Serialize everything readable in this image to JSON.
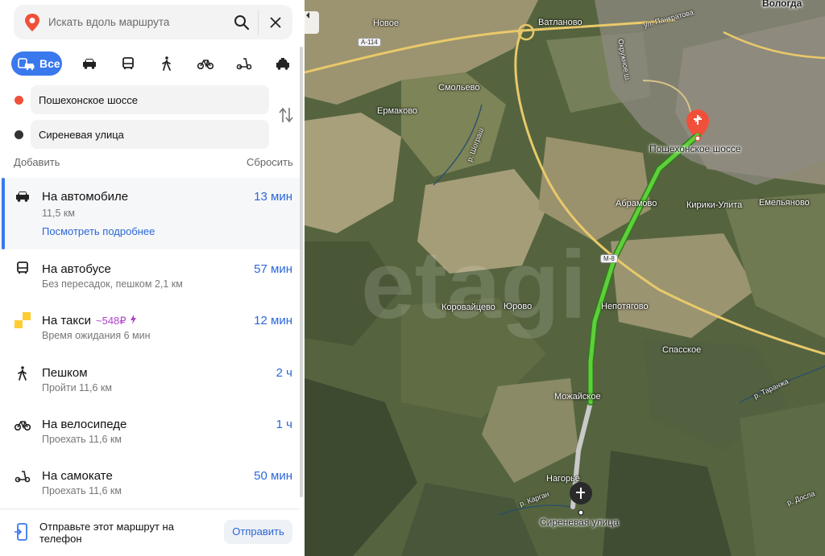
{
  "search": {
    "placeholder": "Искать вдоль маршрута"
  },
  "modes": {
    "all_label": "Все"
  },
  "waypoints": {
    "from": "Пошехонское шоссе",
    "to": "Сиреневая улица"
  },
  "actions": {
    "add": "Добавить",
    "reset": "Сбросить"
  },
  "routes": [
    {
      "title": "На автомобиле",
      "sub": "11,5 км",
      "time": "13 мин",
      "more": "Посмотреть подробнее",
      "icon": "car-icon"
    },
    {
      "title": "На автобусе",
      "sub": "Без пересадок, пешком 2,1 км",
      "time": "57 мин",
      "icon": "bus-icon"
    },
    {
      "title": "На такси",
      "price": "~548₽",
      "sub": "Время ожидания 6 мин",
      "time": "12 мин",
      "icon": "taxi-icon"
    },
    {
      "title": "Пешком",
      "sub": "Пройти 11,6 км",
      "time": "2 ч",
      "icon": "walk-icon"
    },
    {
      "title": "На велосипеде",
      "sub": "Проехать 11,6 км",
      "time": "1 ч",
      "icon": "bicycle-icon"
    },
    {
      "title": "На самокате",
      "sub": "Проехать 11,6 км",
      "time": "50 мин",
      "icon": "scooter-icon"
    }
  ],
  "footer": {
    "text": "Отправьте этот маршрут на телефон",
    "button": "Отправить"
  },
  "map": {
    "start_label": "Пошехонское шоссе",
    "end_label": "Сиреневая улица",
    "places": {
      "vologda": "Вологда",
      "novoe": "Новое",
      "vatlanovo": "Ватланово",
      "smolevo": "Смольево",
      "ermakovo": "Ермаково",
      "abramovo": "Абрамово",
      "kiriki": "Кирики-Улита",
      "emelyanovo": "Емельяново",
      "korovaitsevo": "Коровайцево",
      "yurovo": "Юрово",
      "nepotyagovo": "Непотягово",
      "spasskoe": "Спасское",
      "mozhayskoe": "Можайское",
      "nagorye": "Нагорье",
      "shogra": "р. Шограш",
      "kargach": "р. Карган",
      "tarnoga": "р. Таранжа",
      "dosla": "р. Досла",
      "pankratova": "ул. Панкратова",
      "okruzhnoe": "Окружное ш."
    },
    "highways": {
      "a114": "А-114",
      "m8": "М-8"
    },
    "watermark": "etagi"
  },
  "colors": {
    "accent": "#3a78ed",
    "route": "#5fcf3a",
    "route_grey": "#c9c9c9",
    "start_pin": "#f0503a"
  }
}
